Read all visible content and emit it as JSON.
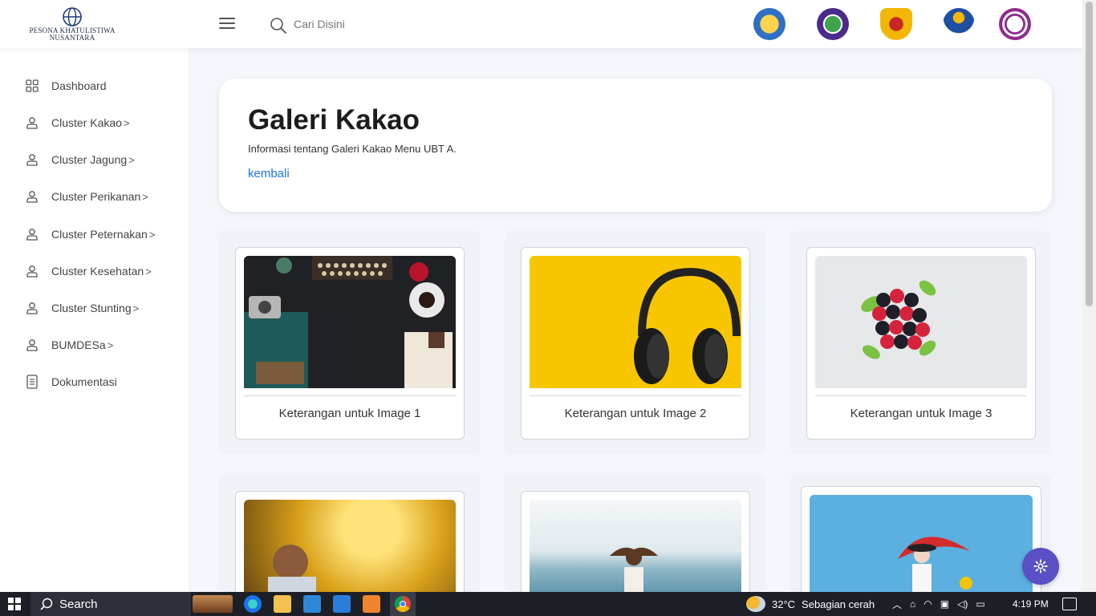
{
  "header": {
    "logo_line1": "PESONA KHATULISTIWA",
    "logo_line2": "NUSANTARA",
    "search_placeholder": "Cari Disini",
    "partners": [
      "kemdikbud-logo",
      "ubt-logo",
      "unpad-logo",
      "pens-logo",
      "university-seal-logo"
    ]
  },
  "sidebar": {
    "items": [
      {
        "label": "Dashboard",
        "icon": "grid-icon",
        "chevron": ""
      },
      {
        "label": "Cluster Kakao",
        "icon": "user-icon",
        "chevron": ">"
      },
      {
        "label": "Cluster Jagung",
        "icon": "user-icon",
        "chevron": ">"
      },
      {
        "label": "Cluster Perikanan",
        "icon": "user-icon",
        "chevron": ">"
      },
      {
        "label": "Cluster Peternakan",
        "icon": "user-icon",
        "chevron": ">"
      },
      {
        "label": "Cluster Kesehatan",
        "icon": "user-icon",
        "chevron": ">"
      },
      {
        "label": "Cluster Stunting",
        "icon": "user-icon",
        "chevron": ">"
      },
      {
        "label": "BUMDESa",
        "icon": "user-icon",
        "chevron": ">"
      },
      {
        "label": "Dokumentasi",
        "icon": "document-icon",
        "chevron": ""
      }
    ]
  },
  "main": {
    "title": "Galeri Kakao",
    "subtitle": "Informasi tentang Galeri Kakao Menu UBT A.",
    "back_link": "kembali",
    "gallery": [
      {
        "caption": "Keterangan untuk Image 1",
        "image": "desk-typewriter-photo"
      },
      {
        "caption": "Keterangan untuk Image 2",
        "image": "headphones-yellow-photo"
      },
      {
        "caption": "Keterangan untuk Image 3",
        "image": "berries-photo"
      },
      {
        "caption": "",
        "image": "child-splash-photo"
      },
      {
        "caption": "",
        "image": "girl-sea-photo"
      },
      {
        "caption": "",
        "image": "red-umbrella-photo"
      }
    ]
  },
  "taskbar": {
    "search_label": "Search",
    "weather_temp": "32°C",
    "weather_desc": "Sebagian cerah",
    "time": "4:19 PM"
  },
  "colors": {
    "accent": "#1a73e8",
    "fab": "#5a4fc4",
    "background": "#f3f6fb"
  }
}
